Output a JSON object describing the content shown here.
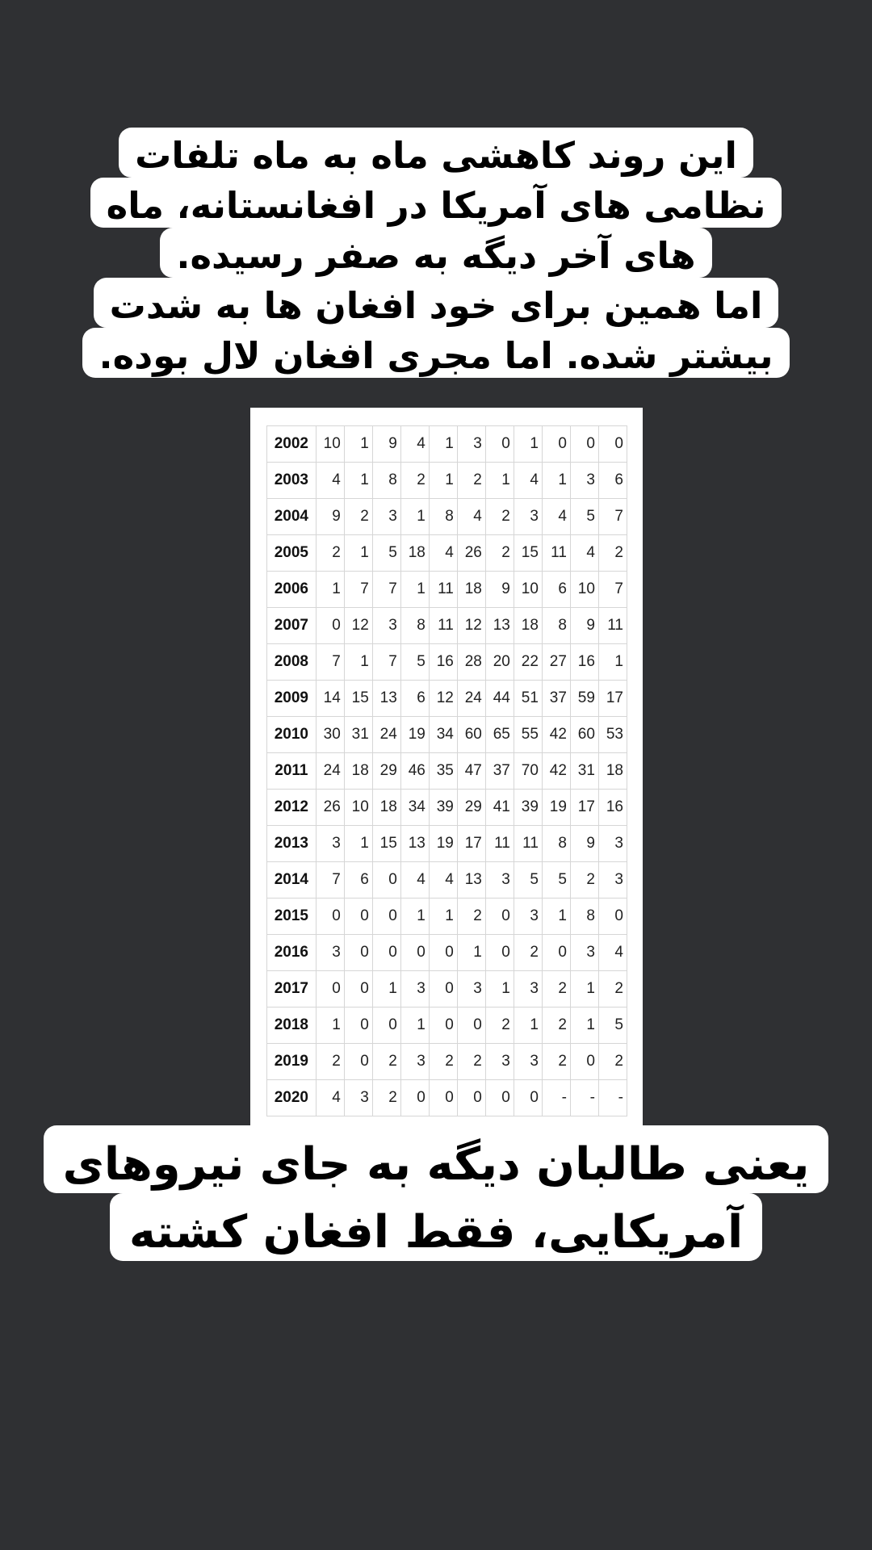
{
  "caption_top": {
    "lines": [
      "این روند کاهشی ماه به ماه تلفات",
      "نظامی های آمریکا در افغانستانه، ماه",
      "های آخر دیگه به صفر رسیده.",
      "اما همین برای خود افغان ها به شدت",
      "بیشتر شده. اما مجری افغان لال بوده."
    ]
  },
  "table": {
    "rows": [
      {
        "year": "2002",
        "values": [
          "10",
          "1",
          "9",
          "4",
          "1",
          "3",
          "0",
          "1",
          "0",
          "0",
          "0"
        ]
      },
      {
        "year": "2003",
        "values": [
          "4",
          "1",
          "8",
          "2",
          "1",
          "2",
          "1",
          "4",
          "1",
          "3",
          "6"
        ]
      },
      {
        "year": "2004",
        "values": [
          "9",
          "2",
          "3",
          "1",
          "8",
          "4",
          "2",
          "3",
          "4",
          "5",
          "7"
        ]
      },
      {
        "year": "2005",
        "values": [
          "2",
          "1",
          "5",
          "18",
          "4",
          "26",
          "2",
          "15",
          "11",
          "4",
          "2"
        ]
      },
      {
        "year": "2006",
        "values": [
          "1",
          "7",
          "7",
          "1",
          "11",
          "18",
          "9",
          "10",
          "6",
          "10",
          "7"
        ]
      },
      {
        "year": "2007",
        "values": [
          "0",
          "12",
          "3",
          "8",
          "11",
          "12",
          "13",
          "18",
          "8",
          "9",
          "11"
        ]
      },
      {
        "year": "2008",
        "values": [
          "7",
          "1",
          "7",
          "5",
          "16",
          "28",
          "20",
          "22",
          "27",
          "16",
          "1"
        ]
      },
      {
        "year": "2009",
        "values": [
          "14",
          "15",
          "13",
          "6",
          "12",
          "24",
          "44",
          "51",
          "37",
          "59",
          "17"
        ]
      },
      {
        "year": "2010",
        "values": [
          "30",
          "31",
          "24",
          "19",
          "34",
          "60",
          "65",
          "55",
          "42",
          "60",
          "53"
        ]
      },
      {
        "year": "2011",
        "values": [
          "24",
          "18",
          "29",
          "46",
          "35",
          "47",
          "37",
          "70",
          "42",
          "31",
          "18"
        ]
      },
      {
        "year": "2012",
        "values": [
          "26",
          "10",
          "18",
          "34",
          "39",
          "29",
          "41",
          "39",
          "19",
          "17",
          "16"
        ]
      },
      {
        "year": "2013",
        "values": [
          "3",
          "1",
          "15",
          "13",
          "19",
          "17",
          "11",
          "11",
          "8",
          "9",
          "3"
        ]
      },
      {
        "year": "2014",
        "values": [
          "7",
          "6",
          "0",
          "4",
          "4",
          "13",
          "3",
          "5",
          "5",
          "2",
          "3"
        ]
      },
      {
        "year": "2015",
        "values": [
          "0",
          "0",
          "0",
          "1",
          "1",
          "2",
          "0",
          "3",
          "1",
          "8",
          "0"
        ]
      },
      {
        "year": "2016",
        "values": [
          "3",
          "0",
          "0",
          "0",
          "0",
          "1",
          "0",
          "2",
          "0",
          "3",
          "4"
        ]
      },
      {
        "year": "2017",
        "values": [
          "0",
          "0",
          "1",
          "3",
          "0",
          "3",
          "1",
          "3",
          "2",
          "1",
          "2"
        ]
      },
      {
        "year": "2018",
        "values": [
          "1",
          "0",
          "0",
          "1",
          "0",
          "0",
          "2",
          "1",
          "2",
          "1",
          "5"
        ]
      },
      {
        "year": "2019",
        "values": [
          "2",
          "0",
          "2",
          "3",
          "2",
          "2",
          "3",
          "3",
          "2",
          "0",
          "2"
        ]
      },
      {
        "year": "2020",
        "values": [
          "4",
          "3",
          "2",
          "0",
          "0",
          "0",
          "0",
          "0",
          "-",
          "-",
          "-"
        ]
      }
    ]
  },
  "caption_bottom": {
    "lines": [
      "یعنی طالبان دیگه به جای نیروهای",
      "آمریکایی، فقط افغان کشته"
    ]
  }
}
